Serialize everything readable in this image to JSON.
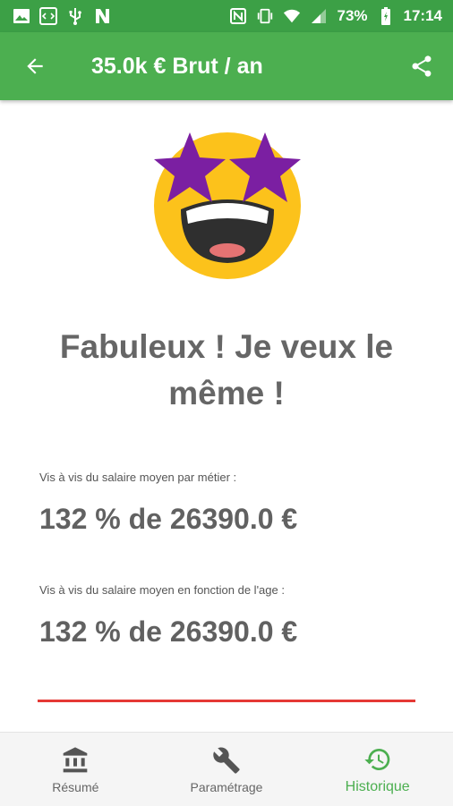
{
  "status_bar": {
    "battery": "73%",
    "time": "17:14",
    "left_icons": [
      "image-icon",
      "code-icon",
      "usb-icon",
      "n-app-icon"
    ],
    "right_icons": [
      "nfc-icon",
      "vibrate-icon",
      "wifi-icon",
      "signal-icon",
      "battery-icon"
    ]
  },
  "toolbar": {
    "title": "35.0k € Brut / an",
    "color": "#4caf50"
  },
  "main": {
    "headline": "Fabuleux ! Je veux le même !",
    "comparisons": [
      {
        "label": "Vis à vis du salaire moyen par métier :",
        "value": "132 % de 26390.0 €"
      },
      {
        "label": "Vis à vis du salaire moyen en fonction de l'age :",
        "value": "132 % de 26390.0 €"
      }
    ],
    "accent_line_color": "#e53935"
  },
  "bottom_nav": {
    "items": [
      {
        "label": "Résumé",
        "icon": "bank-icon",
        "active": false
      },
      {
        "label": "Paramétrage",
        "icon": "wrench-icon",
        "active": false
      },
      {
        "label": "Historique",
        "icon": "history-icon",
        "active": true
      }
    ]
  }
}
